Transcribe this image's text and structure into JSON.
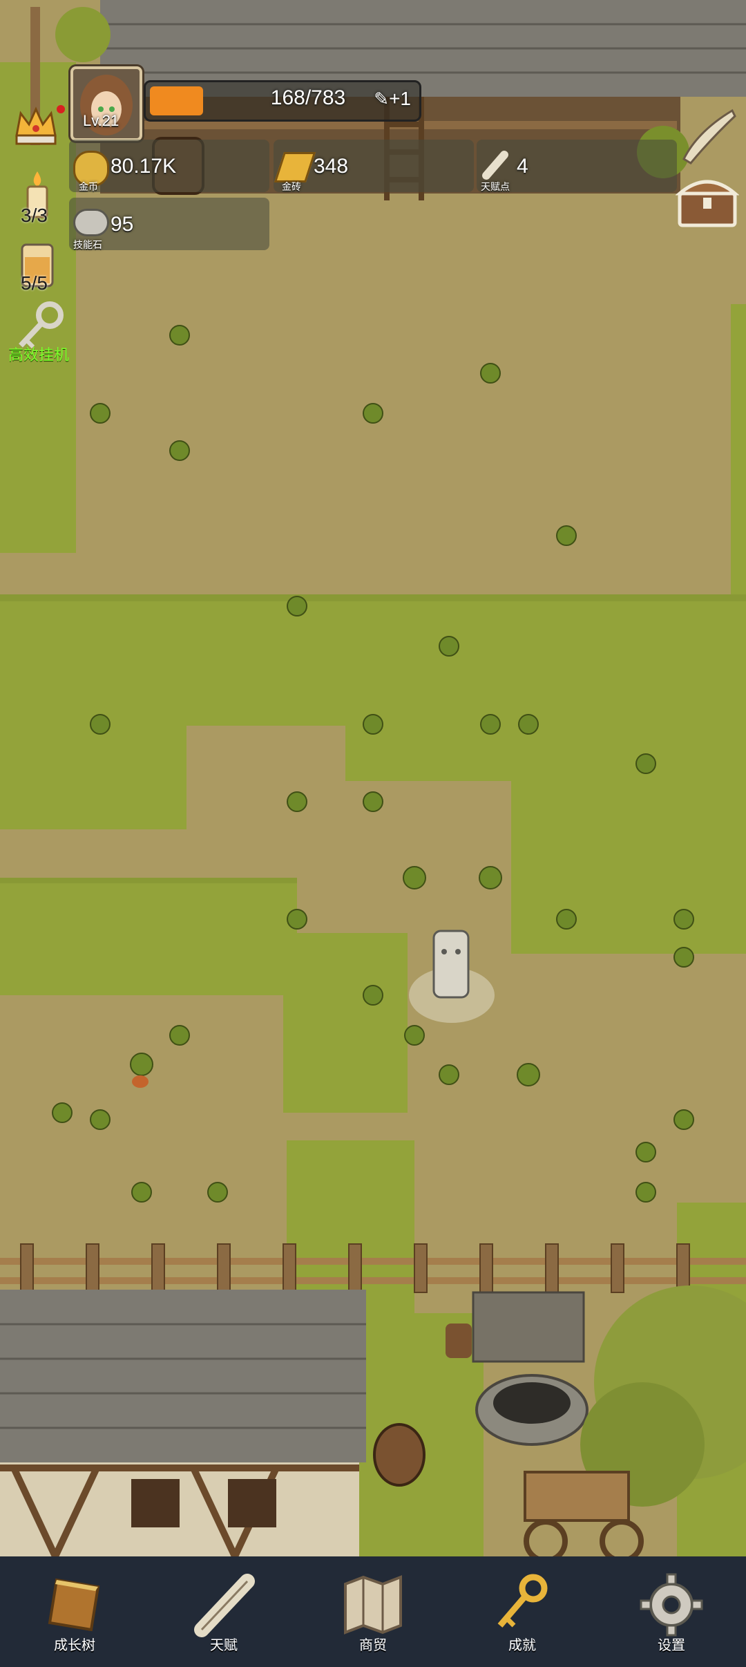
{
  "player": {
    "level": "Lv.21"
  },
  "exp": {
    "text": "168/783",
    "fill_fraction": 0.2,
    "bonus": "+1"
  },
  "resources": {
    "gold": {
      "value": "80.17K",
      "label": "金币"
    },
    "gold_brick": {
      "value": "348",
      "label": "金砖"
    },
    "talent_points": {
      "value": "4",
      "label": "天赋点"
    },
    "skill_stone": {
      "value": "95",
      "label": "技能石"
    }
  },
  "side": {
    "candle_count": "3/3",
    "drink_count": "5/5",
    "afk_label": "高效挂机"
  },
  "nav": [
    {
      "key": "growth",
      "label": "成长树",
      "icon": "book-icon"
    },
    {
      "key": "talent",
      "label": "天赋",
      "icon": "scroll-icon"
    },
    {
      "key": "trade",
      "label": "商贸",
      "icon": "map-icon"
    },
    {
      "key": "achieve",
      "label": "成就",
      "icon": "key-icon"
    },
    {
      "key": "settings",
      "label": "设置",
      "icon": "gear-icon"
    }
  ],
  "colors": {
    "nav_bg": "#222a37",
    "exp_fill": "#f08a1f",
    "grass": "#8fa23a",
    "dirt": "#a99860",
    "afk_green": "#7cff2a"
  }
}
